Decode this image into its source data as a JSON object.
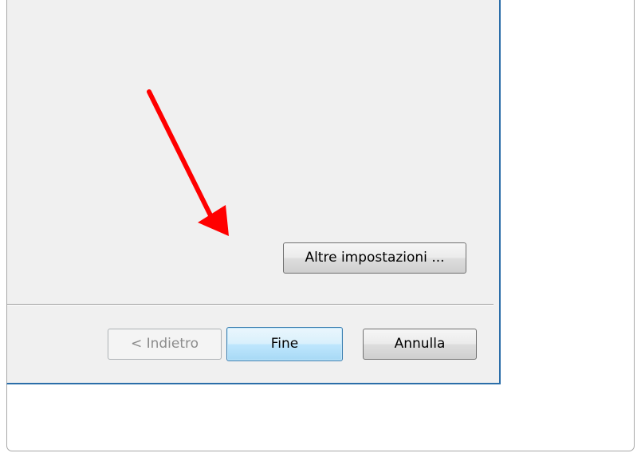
{
  "dialog": {
    "more_settings_label": "Altre impostazioni ...",
    "back_label": "< Indietro",
    "finish_label": "Fine",
    "cancel_label": "Annulla"
  },
  "colors": {
    "dialog_background": "#f0f0f0",
    "window_border": "#2b6ea9",
    "annotation_arrow": "#ff0000",
    "default_button_tint": "#bee6fd",
    "disabled_text": "#8c8c8c"
  },
  "icons": {
    "annotation": "red-arrow-pointing-down-right"
  }
}
